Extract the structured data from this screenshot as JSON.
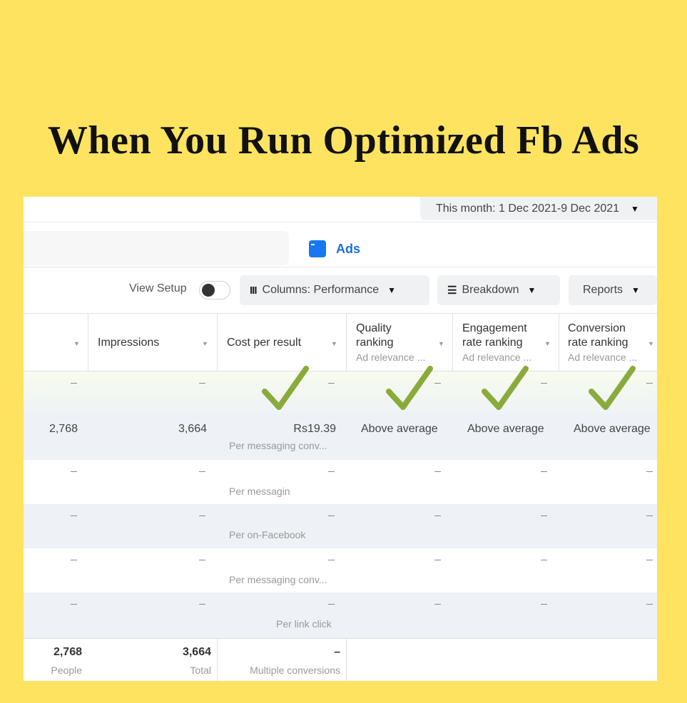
{
  "headline": "When You Run Optimized Fb Ads",
  "date_range": "This month: 1 Dec 2021-9 Dec 2021",
  "tab": {
    "label": "Ads",
    "icon": "ads-icon"
  },
  "toolbar": {
    "view_setup": "View Setup",
    "columns": "Columns: Performance",
    "breakdown": "Breakdown",
    "reports": "Reports"
  },
  "columns": [
    {
      "label": "Impressions"
    },
    {
      "label": "Cost per result"
    },
    {
      "label_line1": "Quality",
      "label_line2": "ranking",
      "sub": "Ad relevance ..."
    },
    {
      "label_line1": "Engagement",
      "label_line2": "rate ranking",
      "sub": "Ad relevance ..."
    },
    {
      "label_line1": "Conversion",
      "label_line2": "rate ranking",
      "sub": "Ad relevance ..."
    }
  ],
  "dash": "–",
  "rows": [
    {
      "reach": "2,768",
      "impressions": "3,664",
      "cost": "Rs19.39",
      "cost_sub": "Per messaging conv...",
      "quality": "Above average",
      "engagement": "Above average",
      "conversion": "Above average"
    },
    {
      "cost_sub": "Per messagin"
    },
    {
      "cost_sub": "Per on-Facebook"
    },
    {
      "cost_sub": "Per messaging conv..."
    },
    {
      "cost_sub": "Per link click"
    }
  ],
  "totals": {
    "reach": "2,768",
    "reach_sub": "People",
    "impressions": "3,664",
    "impressions_sub": "Total",
    "cost": "–",
    "cost_sub": "Multiple conversions"
  },
  "colors": {
    "background": "#fde35f",
    "accent": "#1877f2",
    "check": "#8aab3a"
  }
}
